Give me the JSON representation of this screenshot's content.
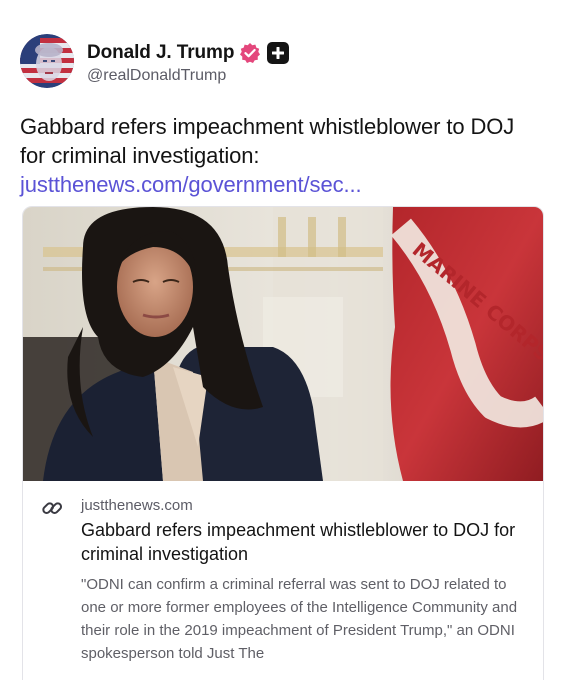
{
  "author": {
    "name": "Donald J. Trump",
    "handle": "@realDonaldTrump"
  },
  "post": {
    "text": "Gabbard refers impeachment whistleblower to DOJ for criminal investigation: ",
    "link_text": "justthenews.com/government/sec..."
  },
  "link_card": {
    "domain": "justthenews.com",
    "title": "Gabbard refers impeachment whistleblower to DOJ for criminal investigation",
    "description": "\"ODNI can confirm a criminal referral was sent to DOJ related to one or more former employees of the Intelligence Community and their role in the 2019 impeachment of President Trump,\" an ODNI spokesperson told Just The",
    "image_flag_text": "MARINE CORPS"
  },
  "colors": {
    "link": "#5b53d6",
    "verified_badge": "#e4477c",
    "text_primary": "#141414",
    "text_secondary": "#5c5c66"
  },
  "icons": {
    "verified": "verified-badge-icon",
    "plus": "plus-badge-icon",
    "link": "link-chain-icon"
  }
}
